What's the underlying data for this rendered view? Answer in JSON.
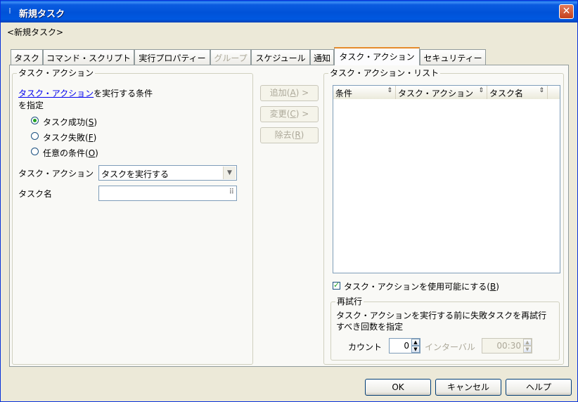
{
  "window": {
    "title": "新規タスク",
    "subtitle": "<新規タスク>"
  },
  "tabs": [
    {
      "label": "タスク",
      "state": "normal"
    },
    {
      "label": "コマンド・スクリプト",
      "state": "normal"
    },
    {
      "label": "実行プロパティー",
      "state": "normal"
    },
    {
      "label": "グループ",
      "state": "disabled"
    },
    {
      "label": "スケジュール",
      "state": "normal"
    },
    {
      "label": "通知",
      "state": "normal"
    },
    {
      "label": "タスク・アクション",
      "state": "active"
    },
    {
      "label": "セキュリティー",
      "state": "normal"
    }
  ],
  "left_group": {
    "legend": "タスク・アクション",
    "desc_link": "タスク・アクション",
    "desc_rest": "を実行する条件",
    "desc_line2": "を指定",
    "radios": [
      {
        "label": "タスク成功",
        "key": "S",
        "selected": true
      },
      {
        "label": "タスク失敗",
        "key": "F",
        "selected": false
      },
      {
        "label": "任意の条件",
        "key": "O",
        "selected": false
      }
    ],
    "action_label": "タスク・アクション",
    "action_value": "タスクを実行する",
    "taskname_label": "タスク名",
    "taskname_value": ""
  },
  "middle_buttons": {
    "add": {
      "label": "追加",
      "key": "A",
      "suffix": " >"
    },
    "change": {
      "label": "変更",
      "key": "C",
      "suffix": " >"
    },
    "remove": {
      "label": "除去",
      "key": "R",
      "suffix": ""
    }
  },
  "right_group": {
    "legend": "タスク・アクション・リスト",
    "columns": [
      "条件",
      "タスク・アクション",
      "タスク名"
    ],
    "rows": [],
    "enable_label": "タスク・アクションを使用可能にする",
    "enable_key": "B",
    "enable_checked": true,
    "retry": {
      "legend": "再試行",
      "desc_line1": "タスク・アクションを実行する前に失敗タスクを再試行",
      "desc_line2": "すべき回数を指定",
      "count_label": "カウント",
      "count_value": "0",
      "interval_label": "インターバル",
      "interval_value": "00:30"
    }
  },
  "footer": {
    "ok": "OK",
    "cancel": "キャンセル",
    "help": "ヘルプ"
  },
  "colors": {
    "title_bar": "#0052d8",
    "tab_active_accent": "#e68b2c",
    "link": "#0000ee",
    "disabled_text": "#aca899"
  }
}
